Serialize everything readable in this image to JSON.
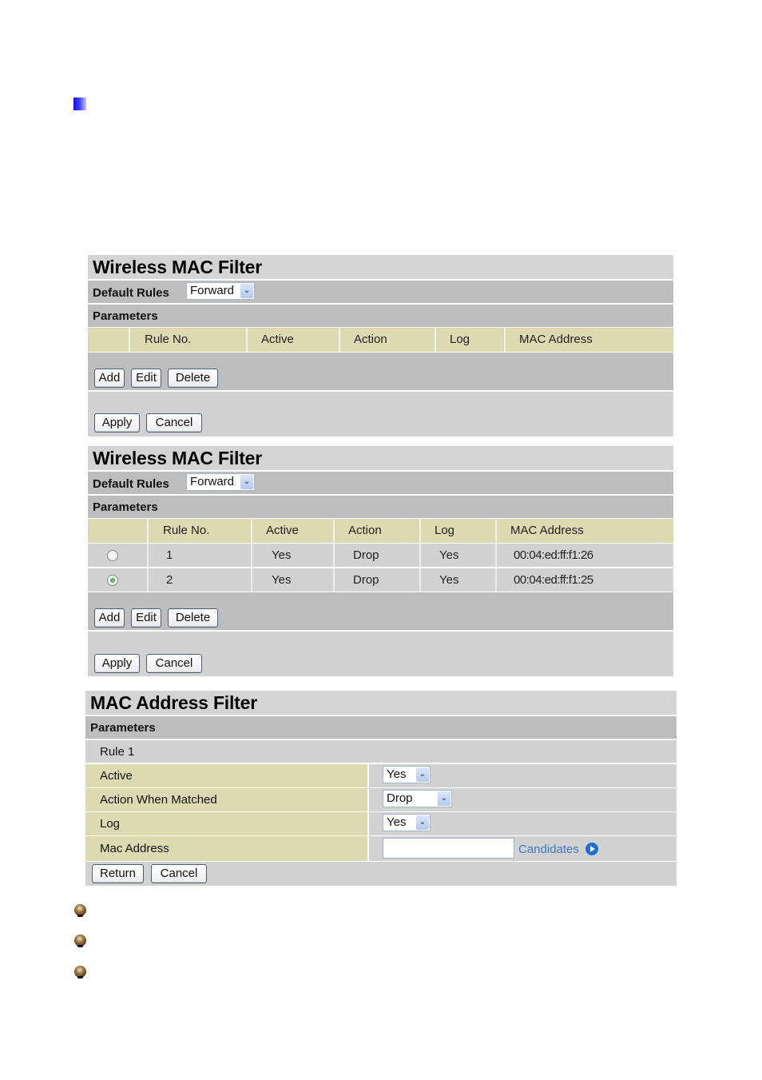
{
  "panel1": {
    "title": "Wireless MAC Filter",
    "default_rules_label": "Default Rules",
    "default_rules_value": "Forward",
    "parameters_label": "Parameters",
    "columns": [
      "",
      "Rule No.",
      "Active",
      "Action",
      "Log",
      "MAC Address"
    ],
    "buttons": {
      "add": "Add",
      "edit": "Edit",
      "delete": "Delete",
      "apply": "Apply",
      "cancel": "Cancel"
    }
  },
  "panel2": {
    "title": "Wireless MAC Filter",
    "default_rules_label": "Default Rules",
    "default_rules_value": "Forward",
    "parameters_label": "Parameters",
    "columns": [
      "",
      "Rule No.",
      "Active",
      "Action",
      "Log",
      "MAC Address"
    ],
    "rows": [
      {
        "selected": false,
        "rule_no": "1",
        "active": "Yes",
        "action": "Drop",
        "log": "Yes",
        "mac": "00:04:ed:ff:f1:26"
      },
      {
        "selected": true,
        "rule_no": "2",
        "active": "Yes",
        "action": "Drop",
        "log": "Yes",
        "mac": "00:04:ed:ff:f1:25"
      }
    ],
    "buttons": {
      "add": "Add",
      "edit": "Edit",
      "delete": "Delete",
      "apply": "Apply",
      "cancel": "Cancel"
    }
  },
  "panel3": {
    "title": "MAC Address Filter",
    "parameters_label": "Parameters",
    "rule_label": "Rule 1",
    "fields": {
      "active_label": "Active",
      "active_value": "Yes",
      "action_label": "Action When Matched",
      "action_value": "Drop",
      "log_label": "Log",
      "log_value": "Yes",
      "mac_label": "Mac Address",
      "mac_value": "",
      "candidates_link": "Candidates"
    },
    "buttons": {
      "return": "Return",
      "cancel": "Cancel"
    }
  },
  "icons": {
    "section_bullet": "blue-gradient-square",
    "list_bullets": [
      "bronze-ball",
      "bronze-ball",
      "bronze-ball"
    ],
    "candidates_icon": "blue-play-circle"
  }
}
